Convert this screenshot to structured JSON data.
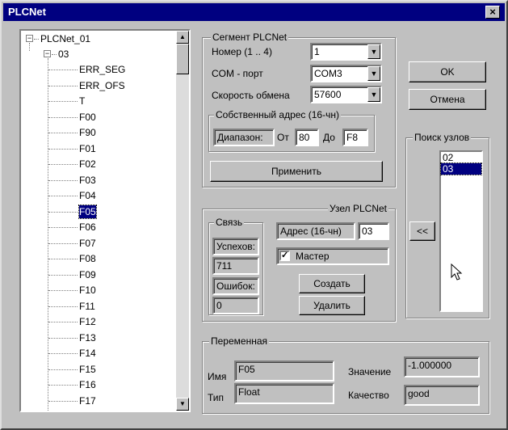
{
  "window": {
    "title": "PLCNet",
    "close_label": "×"
  },
  "tree": {
    "root": "PLCNet_01",
    "root_toggle": "−",
    "child": "03",
    "child_toggle": "−",
    "items": [
      "ERR_SEG",
      "ERR_OFS",
      "T",
      "F00",
      "F90",
      "F01",
      "F02",
      "F03",
      "F04",
      "F05",
      "F06",
      "F07",
      "F08",
      "F09",
      "F10",
      "F11",
      "F12",
      "F13",
      "F14",
      "F15",
      "F16",
      "F17"
    ],
    "selected": "F05",
    "scroll_up": "▲",
    "scroll_down": "▼"
  },
  "segment": {
    "legend": "Сегмент PLCNet",
    "number_label": "Номер (1 .. 4)",
    "number_value": "1",
    "com_label": "COM - порт",
    "com_value": "COM3",
    "speed_label": "Скорость обмена",
    "speed_value": "57600",
    "own_addr_legend": "Собственный адрес (16-чн)",
    "range_label": "Диапазон:",
    "from_label": "От",
    "from_value": "80",
    "to_label": "До",
    "to_value": "F8",
    "apply_label": "Применить",
    "combo_arrow": "▼"
  },
  "buttons": {
    "ok_label": "OK",
    "cancel_label": "Отмена"
  },
  "search": {
    "legend": "Поиск узлов",
    "items": [
      "02",
      "03"
    ],
    "selected": "03",
    "transfer_label": "<<"
  },
  "node": {
    "legend": "Узел PLCNet",
    "link_legend": "Связь",
    "success_label": "Успехов:",
    "success_value": "711",
    "errors_label": "Ошибок:",
    "errors_value": "0",
    "addr_label": "Адрес (16-чн)",
    "addr_value": "03",
    "master_label": "Мастер",
    "master_check": "✓",
    "create_label": "Создать",
    "delete_label": "Удалить"
  },
  "variable": {
    "legend": "Переменная",
    "name_label": "Имя",
    "name_value": "F05",
    "type_label": "Тип",
    "type_value": "Float",
    "value_label": "Значение",
    "value_value": "-1.000000",
    "quality_label": "Качество",
    "quality_value": "good"
  }
}
